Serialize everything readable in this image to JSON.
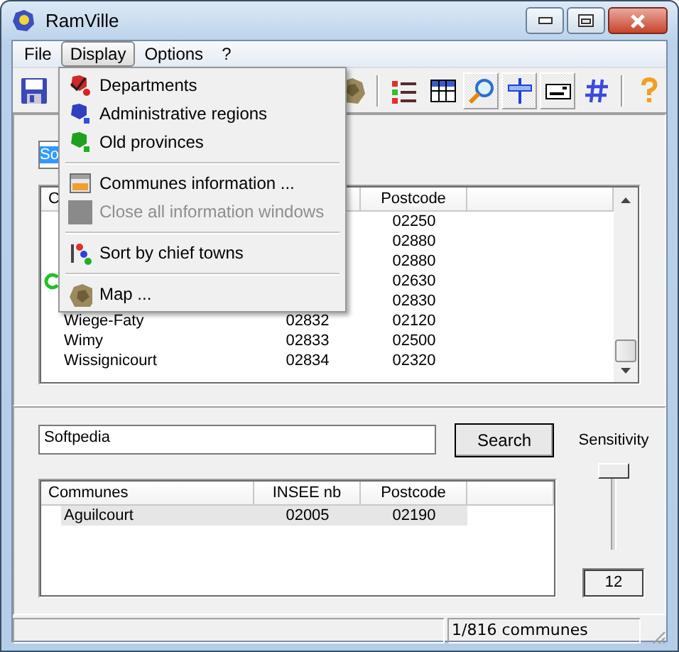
{
  "window": {
    "title": "RamVille"
  },
  "menu_bar": [
    {
      "label": "File",
      "selected": false
    },
    {
      "label": "Display",
      "selected": true
    },
    {
      "label": "Options",
      "selected": false
    },
    {
      "label": "?",
      "selected": false
    }
  ],
  "toolbar": [
    {
      "kind": "save",
      "pressed": false
    },
    {
      "kind": "map",
      "pressed": false
    },
    {
      "kind": "separator"
    },
    {
      "kind": "list",
      "pressed": false
    },
    {
      "kind": "table",
      "pressed": false
    },
    {
      "kind": "search",
      "pressed": true
    },
    {
      "kind": "signpost",
      "pressed": true
    },
    {
      "kind": "card",
      "pressed": true
    },
    {
      "kind": "hash",
      "pressed": false
    },
    {
      "kind": "separator"
    },
    {
      "kind": "help",
      "pressed": false
    }
  ],
  "display_menu": [
    {
      "kind": "departments",
      "label": "Departments",
      "disabled": false
    },
    {
      "kind": "regions",
      "label": "Administrative regions",
      "disabled": false
    },
    {
      "kind": "provinces",
      "label": "Old provinces",
      "disabled": false
    },
    {
      "kind": "separator"
    },
    {
      "kind": "info",
      "label": "Communes information ...",
      "disabled": false
    },
    {
      "kind": "close",
      "label": "Close all information windows",
      "disabled": true
    },
    {
      "kind": "separator"
    },
    {
      "kind": "sort",
      "label": "Sort by chief towns",
      "disabled": false
    },
    {
      "kind": "separator"
    },
    {
      "kind": "map",
      "label": "Map ...",
      "disabled": false
    }
  ],
  "top_search": {
    "value": "So",
    "text_selected": true
  },
  "upper_list": {
    "columns": [
      {
        "kind": "name",
        "label": "C"
      },
      {
        "kind": "insee"
      },
      {
        "kind": "postcode",
        "label": "Postcode"
      }
    ],
    "rows": [
      {
        "postcode": "02250",
        "chief_town": false,
        "selected": false
      },
      {
        "postcode": "02880",
        "chief_town": false,
        "selected": false
      },
      {
        "postcode": "02880",
        "chief_town": false,
        "selected": false
      },
      {
        "postcode": "02630",
        "chief_town": true,
        "selected": false
      },
      {
        "postcode": "02830",
        "chief_town": false,
        "selected": false
      },
      {
        "commune": "Wiege-Faty",
        "insee": "02832",
        "postcode": "02120",
        "chief_town": false,
        "selected": false
      },
      {
        "commune": "Wimy",
        "insee": "02833",
        "postcode": "02500",
        "chief_town": false,
        "selected": false
      },
      {
        "commune": "Wissignicourt",
        "insee": "02834",
        "postcode": "02320",
        "chief_town": false,
        "selected": false
      }
    ]
  },
  "search": {
    "value": "Softpedia",
    "button": "Search"
  },
  "sensitivity": {
    "label": "Sensitivity",
    "level": 1,
    "reading": "12"
  },
  "lower_list": {
    "columns": [
      {
        "kind": "name",
        "label": "Communes"
      },
      {
        "kind": "insee",
        "label": "INSEE nb"
      },
      {
        "kind": "postcode",
        "label": "Postcode"
      }
    ],
    "rows": [
      {
        "commune": "Aguilcourt",
        "insee": "02005",
        "postcode": "02190",
        "chief_town": false,
        "selected": true
      }
    ]
  },
  "status_bar": {
    "count": "1/816 communes"
  }
}
